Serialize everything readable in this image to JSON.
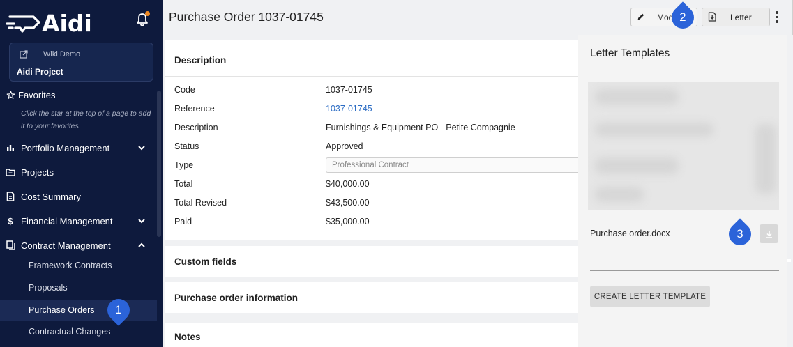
{
  "app": {
    "logo_text": "Aidi",
    "workspace_label": "Wiki Demo",
    "project_name": "Aidi Project"
  },
  "sidebar": {
    "favorites_label": "Favorites",
    "favorites_hint": "Click the star at the top of a page to add it to your favorites",
    "items": [
      {
        "label": "Portfolio Management",
        "icon": "bar-chart-icon",
        "expandable": true
      },
      {
        "label": "Projects",
        "icon": "folder-icon",
        "expandable": false
      },
      {
        "label": "Cost Summary",
        "icon": "document-icon",
        "expandable": false
      },
      {
        "label": "Financial Management",
        "icon": "dollar-icon",
        "expandable": true
      },
      {
        "label": "Contract Management",
        "icon": "copy-icon",
        "expandable": true,
        "expanded": true
      }
    ],
    "sub_items": [
      {
        "label": "Framework Contracts",
        "active": false
      },
      {
        "label": "Proposals",
        "active": false
      },
      {
        "label": "Purchase Orders",
        "active": true
      },
      {
        "label": "Contractual Changes",
        "active": false
      }
    ]
  },
  "header": {
    "title": "Purchase Order 1037-01745",
    "modify_label": "Mod",
    "letter_label": "Letter"
  },
  "description": {
    "title": "Description",
    "fields": [
      {
        "label": "Code",
        "value": "1037-01745"
      },
      {
        "label": "Reference",
        "value": "1037-01745",
        "link": true
      },
      {
        "label": "Description",
        "value": "Furnishings & Equipment PO - Petite Compagnie"
      },
      {
        "label": "Status",
        "value": "Approved"
      },
      {
        "label": "Type",
        "value": "Professional Contract",
        "select": true
      },
      {
        "label": "Total",
        "value": "$40,000.00"
      },
      {
        "label": "Total Revised",
        "value": "$43,500.00"
      },
      {
        "label": "Paid",
        "value": "$35,000.00"
      }
    ]
  },
  "sections": {
    "custom_fields": "Custom fields",
    "po_info": "Purchase order information",
    "notes": "Notes"
  },
  "letter_panel": {
    "title": "Letter Templates",
    "template_name": "Purchase order.docx",
    "create_label": "CREATE LETTER TEMPLATE"
  },
  "callouts": [
    "1",
    "2",
    "3"
  ],
  "colors": {
    "sidebar_bg": "#0e1a3d",
    "sidebar_active": "#1b2a55",
    "accent": "#2b63d9",
    "link": "#2b6cc4",
    "notification": "#f08a24"
  }
}
